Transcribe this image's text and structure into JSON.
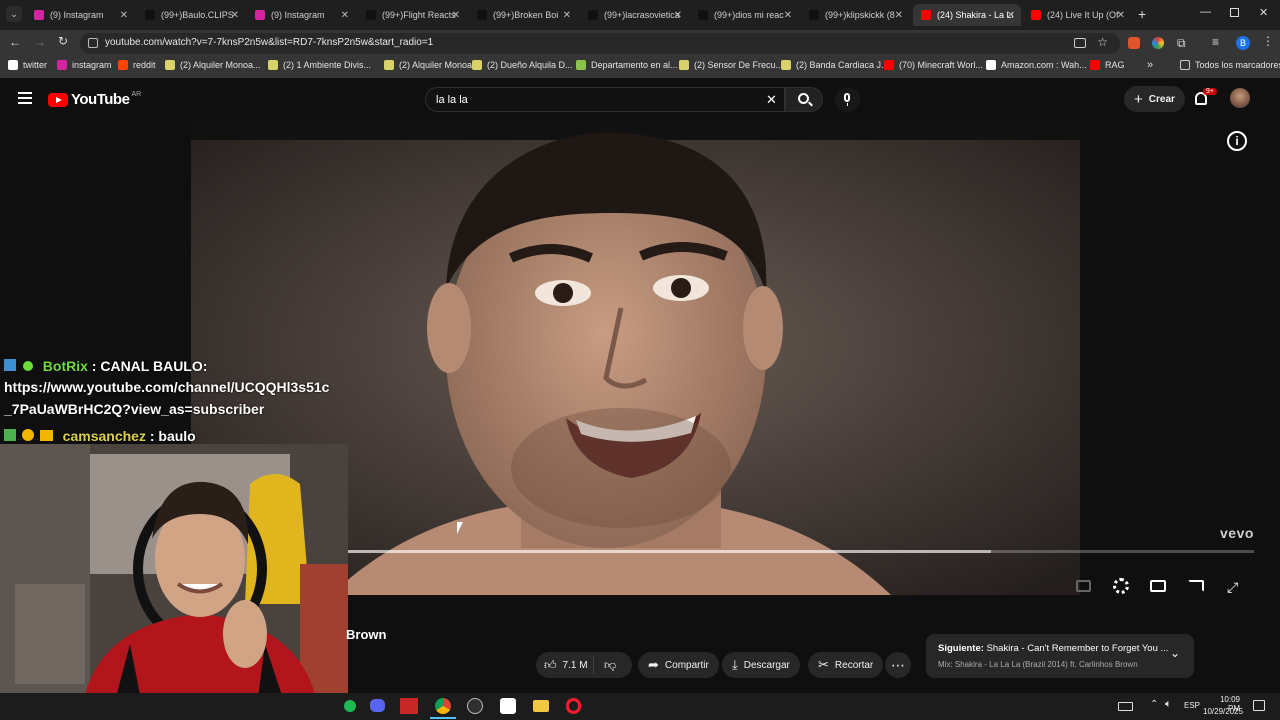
{
  "browser": {
    "tabs": [
      {
        "label": "(9) Instagram",
        "color": "#d6249f"
      },
      {
        "label": "(99+)Baulo.CLIPS",
        "color": "#111111"
      },
      {
        "label": "(9) Instagram",
        "color": "#d6249f"
      },
      {
        "label": "(99+)Flight Reacts",
        "color": "#111111"
      },
      {
        "label": "(99+)Broken Boi",
        "color": "#111111"
      },
      {
        "label": "(99+)lacrasovietica",
        "color": "#111111"
      },
      {
        "label": "(99+)dios mi reac",
        "color": "#111111"
      },
      {
        "label": "(99+)klipskickk (8",
        "color": "#111111"
      },
      {
        "label": "(24) Shakira - La La",
        "color": "#ff0000"
      },
      {
        "label": "(24) Live It Up (Of",
        "color": "#ff0000"
      }
    ],
    "tab_close": "✕",
    "new_tab": "+",
    "url": "youtube.com/watch?v=7-7knsP2n5w&list=RD7-7knsP2n5w&start_radio=1",
    "profile_letter": "B",
    "bookmarks": [
      {
        "label": "twitter",
        "color": "#ffffff"
      },
      {
        "label": "instagram",
        "color": "#d6249f"
      },
      {
        "label": "reddit",
        "color": "#ff4500"
      },
      {
        "label": "(2) Alquiler Monoa...",
        "color": "#d9d16a"
      },
      {
        "label": "(2) 1 Ambiente Divis...",
        "color": "#d9d16a"
      },
      {
        "label": "(2) Alquiler Monoa...",
        "color": "#d9d16a"
      },
      {
        "label": "(2) Dueño Alquila D...",
        "color": "#d9d16a"
      },
      {
        "label": "Departamento en al...",
        "color": "#8bc34a"
      },
      {
        "label": "(2) Sensor De Frecu...",
        "color": "#d9d16a"
      },
      {
        "label": "(2) Banda Cardiaca J...",
        "color": "#d9d16a"
      },
      {
        "label": "(70) Minecraft Worl...",
        "color": "#ff0000"
      },
      {
        "label": "Amazon.com : Wah...",
        "color": "#ffffff"
      },
      {
        "label": "RAG",
        "color": "#ff0000"
      }
    ],
    "bookmarks_more": "»",
    "all_bookmarks": "Todos los marcadores"
  },
  "youtube": {
    "logo_text": "YouTube",
    "region": "AR",
    "search_value": "la la la",
    "create_label": "Crear",
    "notif_badge": "9+",
    "vevo": "vevo",
    "title_partial": "Brown",
    "likes": "7.1 M",
    "share_label": "Compartir",
    "download_label": "Descargar",
    "clip_label": "Recortar",
    "next_label": "Siguiente:",
    "next_title": "Shakira - Can't Remember to Forget You ...",
    "mix_label": "Mix: Shakira - La La La (Brazil 2014) ft. Carlinhos Brown",
    "progress": 0.71,
    "accent": "#ff0000"
  },
  "chat": {
    "line1_user": "BotRix",
    "line1_text": ": CANAL BAULO:",
    "line2": "https://www.youtube.com/channel/UCQQHl3s51c",
    "line3": "_7PaUaWBrHC2Q?view_as=subscriber",
    "line4_user": "camsanchez",
    "line4_text": ": baulo",
    "user1_color": "#6ddc3a",
    "user2_color": "#dbd04a"
  },
  "taskbar": {
    "lang": "ESP",
    "time": "10:09 PM",
    "date": "10/29/2025"
  }
}
